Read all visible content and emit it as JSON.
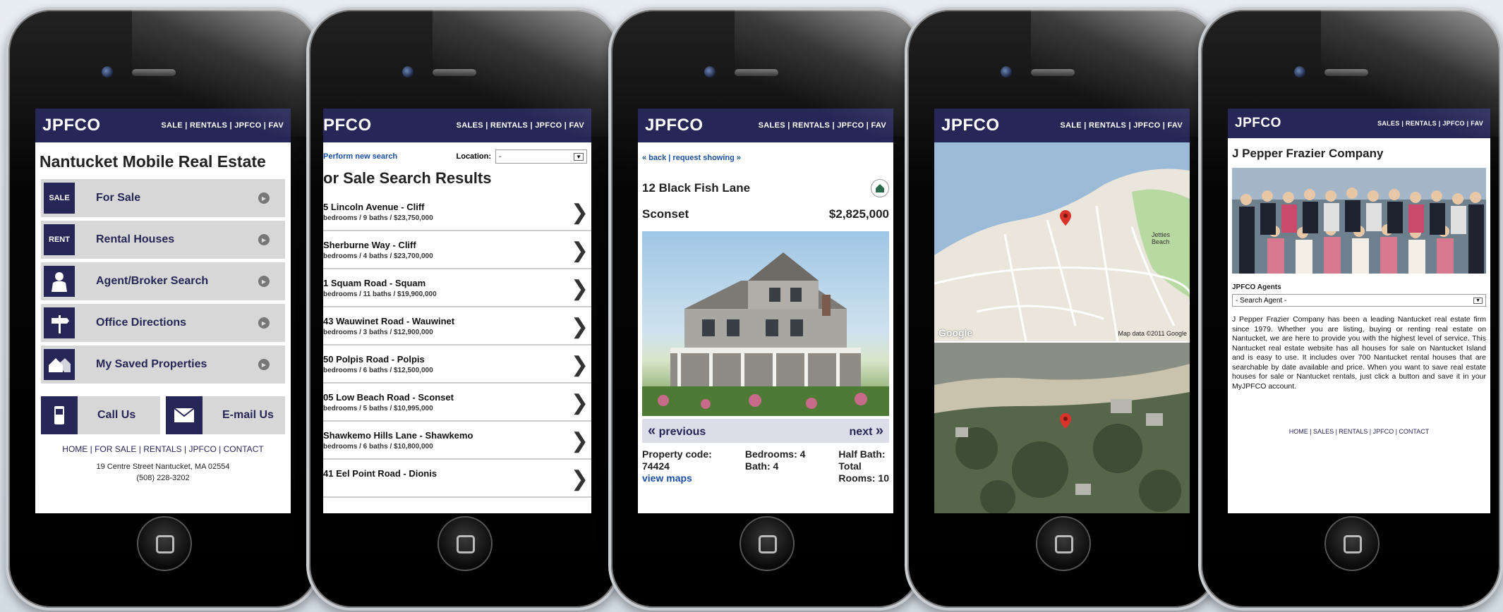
{
  "phone1": {
    "logo": "JPFCO",
    "nav": "SALE | RENTALS | JPFCO | FAV",
    "title": "Nantucket Mobile Real Estate",
    "menu": [
      {
        "label": "For Sale",
        "icon": "for-sale-sign-icon",
        "icon_text": "SALE"
      },
      {
        "label": "Rental Houses",
        "icon": "for-rent-sign-icon",
        "icon_text": "RENT"
      },
      {
        "label": "Agent/Broker Search",
        "icon": "agent-icon",
        "icon_text": ""
      },
      {
        "label": "Office Directions",
        "icon": "signpost-icon",
        "icon_text": ""
      },
      {
        "label": "My Saved Properties",
        "icon": "houses-icon",
        "icon_text": ""
      }
    ],
    "call_label": "Call Us",
    "email_label": "E-mail Us",
    "footer_links": "HOME | FOR SALE | RENTALS | JPFCO | CONTACT",
    "address_line1": "19 Centre Street Nantucket, MA 02554",
    "address_line2": "(508) 228-3202"
  },
  "phone2": {
    "logo": "PFCO",
    "nav": "SALES | RENTALS | JPFCO | FAV",
    "new_search": "Perform new search",
    "location_label": "Location:",
    "location_value": "-",
    "title": "or Sale Search Results",
    "results": [
      {
        "addr": "5 Lincoln Avenue - Cliff",
        "sub": "bedrooms / 9 baths / $23,750,000"
      },
      {
        "addr": "Sherburne Way - Cliff",
        "sub": "bedrooms / 4 baths / $23,700,000"
      },
      {
        "addr": "1 Squam Road - Squam",
        "sub": "bedrooms / 11 baths / $19,900,000"
      },
      {
        "addr": "43 Wauwinet Road - Wauwinet",
        "sub": "bedrooms / 3 baths / $12,900,000"
      },
      {
        "addr": "50 Polpis Road - Polpis",
        "sub": "bedrooms / 6 baths / $12,500,000"
      },
      {
        "addr": "05 Low Beach Road - Sconset",
        "sub": "bedrooms / 5 baths / $10,995,000"
      },
      {
        "addr": "Shawkemo Hills Lane - Shawkemo",
        "sub": "bedrooms / 6 baths / $10,800,000"
      },
      {
        "addr": "41 Eel Point Road - Dionis",
        "sub": ""
      }
    ]
  },
  "phone3": {
    "logo": "JPFCO",
    "nav": "SALES | RENTALS | JPFCO | FAV",
    "links": "« back | request showing »",
    "address": "12 Black Fish Lane",
    "village": "Sconset",
    "price": "$2,825,000",
    "previous": "previous",
    "next": "next",
    "code_label": "Property code:",
    "code_value": "74424",
    "view_maps": "view maps",
    "bedrooms": "Bedrooms: 4",
    "bath": "Bath: 4",
    "half_bath": "Half Bath:",
    "total": "Total",
    "rooms": "Rooms: 10"
  },
  "phone4": {
    "logo": "JPFCO",
    "nav": "SALE | RENTALS | JPFCO | FAV",
    "map_credit": "Map data ©2011 Google",
    "google": "Google",
    "beach_label": "Jetties Beach"
  },
  "phone5": {
    "logo": "JPFCO",
    "nav": "SALES | RENTALS | JPFCO | FAV",
    "title": "J Pepper Frazier Company",
    "agents_label": "JPFCO Agents",
    "agent_select": "- Search Agent -",
    "body": "J Pepper Frazier Company has been a leading Nantucket real estate firm since 1979. Whether you are listing, buying or renting real estate on Nantucket, we are here to provide you with the highest level of service. This Nantucket real estate website has all houses for sale on Nantucket Island and is easy to use. It includes over 700 Nantucket rental houses that are searchable by date available and price. When you want to save real estate houses for sale or Nantucket rentals, just click a button and save it in your MyJPFCO account.",
    "footer_links": "HOME | SALES | RENTALS | JPFCO | CONTACT"
  }
}
